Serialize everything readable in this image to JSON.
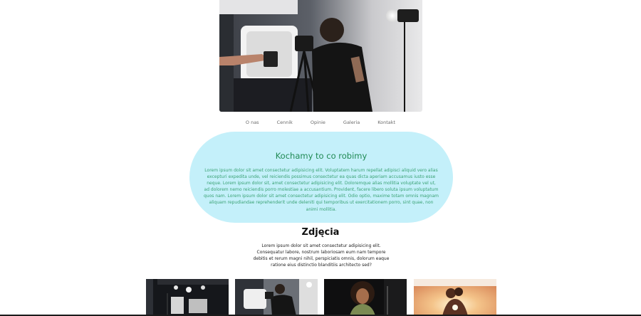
{
  "nav": {
    "items": [
      {
        "label": "O nas"
      },
      {
        "label": "Cennik"
      },
      {
        "label": "Opinie"
      },
      {
        "label": "Galeria"
      },
      {
        "label": "Kontakt"
      }
    ]
  },
  "about": {
    "title": "Kochamy to co robimy",
    "text": "Lorem ipsum dolor sit amet consectetur adipisicing elit. Voluptatem harum repellat adipisci aliquid vero alias excepturi expedita unde, vel reiciendis possimus consectetur ea quas dicta aperiam accusamus iusto esse neque. Lorem ipsum dolor sit, amet consectetur adipisicing elit. Doloremque alias mollitia voluptate vel ut, ad dolorem nemo reiciendis porro molestiae a accusantium. Provident, facere libero soluta ipsum voluptatum quos nam. Lorem ipsum dolor sit amet consectetur adipisicing elit. Odio optio, maxime totam omnis magnam aliquam repudiandae reprehenderit unde deleniti qui temporibus ut exercitationem porro, sint quae, non animi mollitia."
  },
  "photos": {
    "title": "Zdjęcia",
    "text": "Lorem ipsum dolor sit amet consectetur adipisicing elit. Consequatur labore, nostrum laboriosam eum nam tempore debitis et rerum magni nihil, perspiciatis omnis, dolorum eaque ratione eius distinctio blanditiis architecto sed?"
  },
  "colors": {
    "pill_background": "#c4f0fa",
    "pill_title": "#208a54",
    "pill_text": "#3aa274"
  }
}
